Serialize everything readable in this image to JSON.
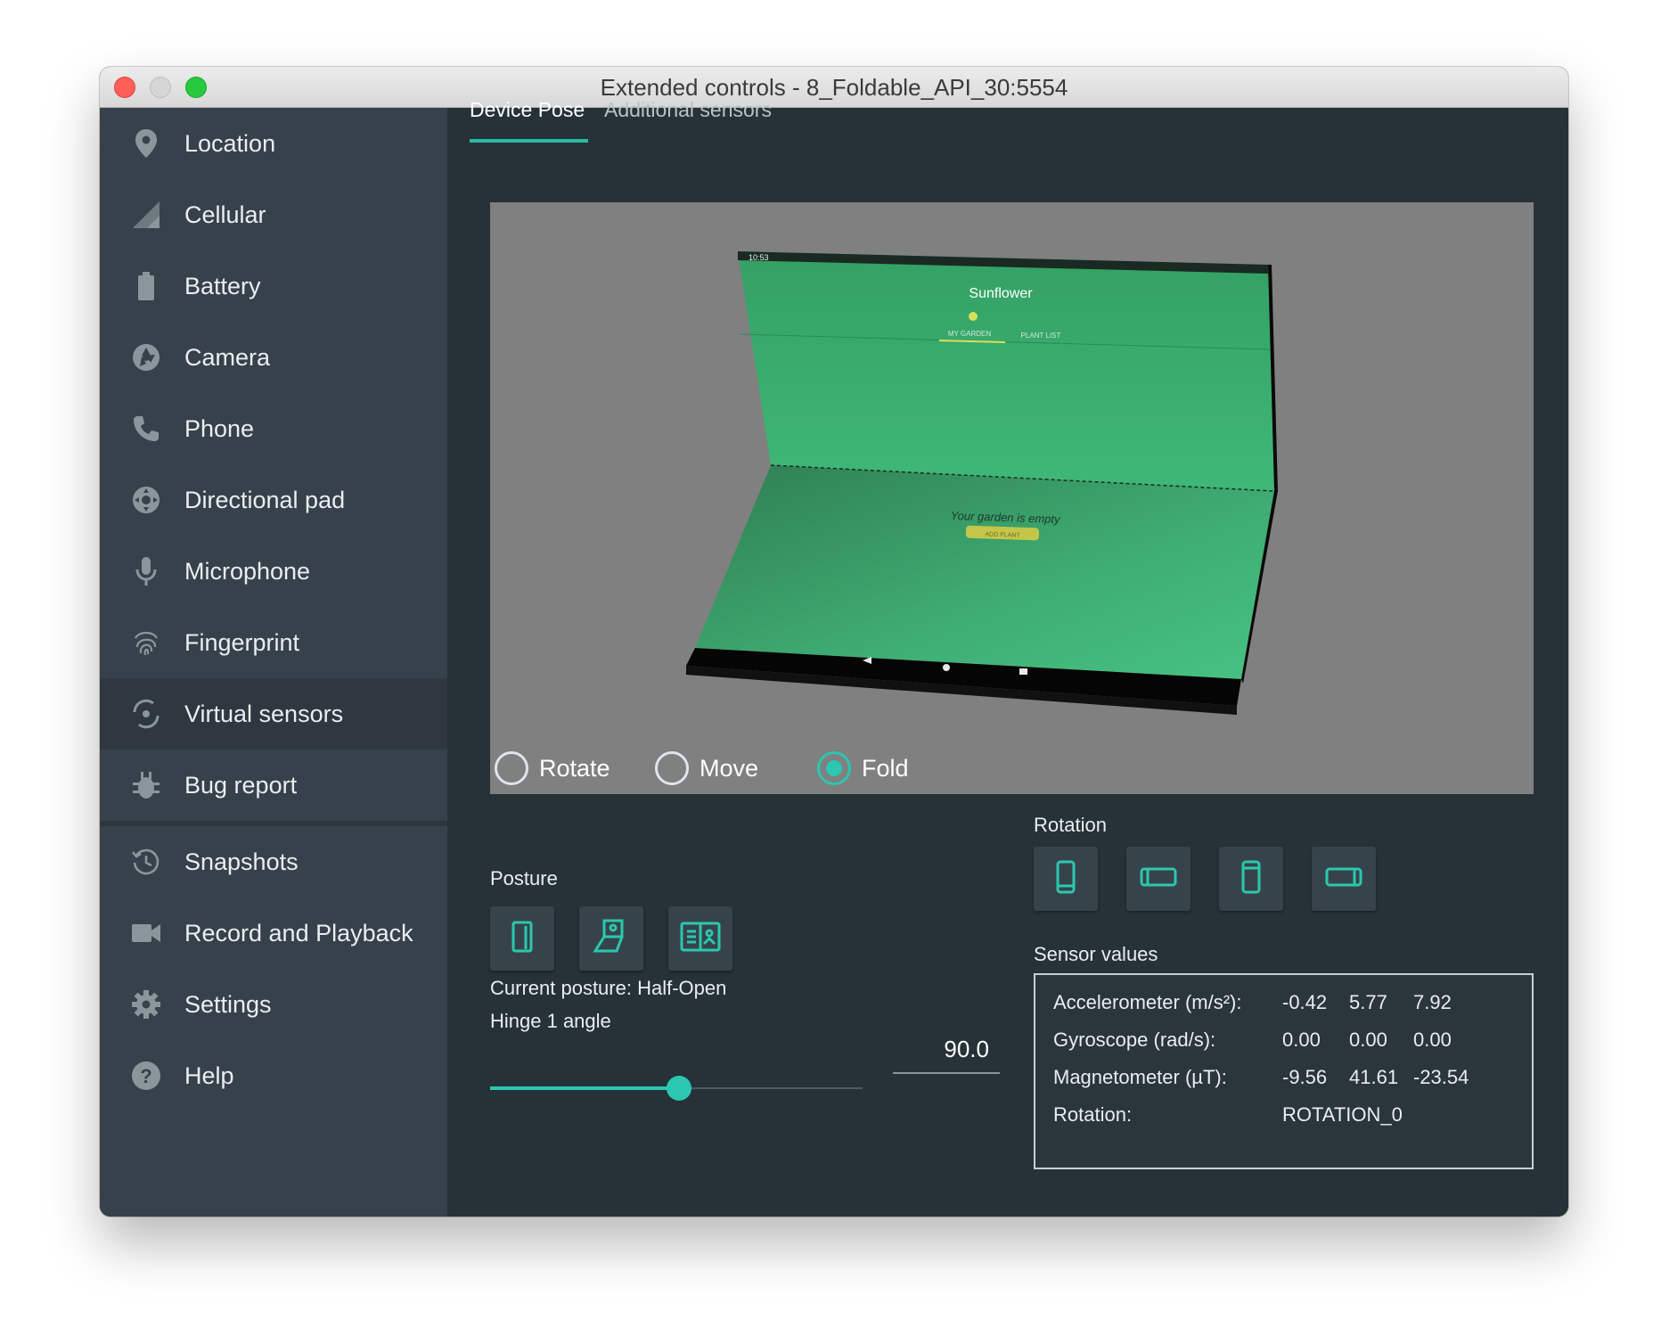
{
  "window": {
    "title": "Extended controls - 8_Foldable_API_30:5554"
  },
  "sidebar": {
    "items": [
      {
        "label": "Location",
        "icon": "location-pin-icon"
      },
      {
        "label": "Cellular",
        "icon": "cellular-signal-icon"
      },
      {
        "label": "Battery",
        "icon": "battery-icon"
      },
      {
        "label": "Camera",
        "icon": "camera-aperture-icon"
      },
      {
        "label": "Phone",
        "icon": "phone-icon"
      },
      {
        "label": "Directional pad",
        "icon": "dpad-icon"
      },
      {
        "label": "Microphone",
        "icon": "microphone-icon"
      },
      {
        "label": "Fingerprint",
        "icon": "fingerprint-icon"
      },
      {
        "label": "Virtual sensors",
        "icon": "virtual-sensors-icon",
        "active": true
      },
      {
        "label": "Bug report",
        "icon": "bug-icon"
      },
      {
        "label": "Snapshots",
        "icon": "snapshot-history-icon"
      },
      {
        "label": "Record and Playback",
        "icon": "video-camera-icon"
      },
      {
        "label": "Settings",
        "icon": "gear-icon"
      },
      {
        "label": "Help",
        "icon": "help-icon"
      }
    ]
  },
  "tabs": [
    {
      "label": "Device Pose",
      "active": true
    },
    {
      "label": "Additional sensors",
      "active": false
    }
  ],
  "device_screen": {
    "status_time": "10:53",
    "app_title": "Sunflower",
    "tab_my_garden": "MY GARDEN",
    "tab_plant_list": "PLANT LIST",
    "empty_message": "Your garden is empty",
    "add_plant_button": "ADD PLANT"
  },
  "modes": [
    {
      "label": "Rotate",
      "checked": false
    },
    {
      "label": "Move",
      "checked": false
    },
    {
      "label": "Fold",
      "checked": true
    }
  ],
  "posture": {
    "heading": "Posture",
    "current": "Current posture: Half-Open",
    "buttons": [
      "posture-closed-icon",
      "posture-tabletop-icon",
      "posture-open-icon"
    ]
  },
  "hinge": {
    "label": "Hinge 1 angle",
    "value": "90.0",
    "slider_fraction": 0.5
  },
  "rotation": {
    "heading": "Rotation",
    "buttons": [
      "rotate-portrait-icon",
      "rotate-landscape-icon",
      "rotate-reverse-portrait-icon",
      "rotate-reverse-landscape-icon"
    ]
  },
  "sensors": {
    "heading": "Sensor values",
    "rows": [
      {
        "label": "Accelerometer (m/s²):",
        "values": [
          "-0.42",
          "5.77",
          "7.92"
        ]
      },
      {
        "label": "Gyroscope (rad/s):",
        "values": [
          "0.00",
          "0.00",
          "0.00"
        ]
      },
      {
        "label": "Magnetometer (µT):",
        "values": [
          "-9.56",
          "41.61",
          "-23.54"
        ]
      },
      {
        "label": "Rotation:",
        "values": [
          "ROTATION_0"
        ]
      }
    ]
  },
  "colors": {
    "accent": "#2bc7b0",
    "sidebar_bg": "#37414b",
    "main_bg": "#263238",
    "viewport_bg": "#808080",
    "device_green": "#3fae74"
  }
}
